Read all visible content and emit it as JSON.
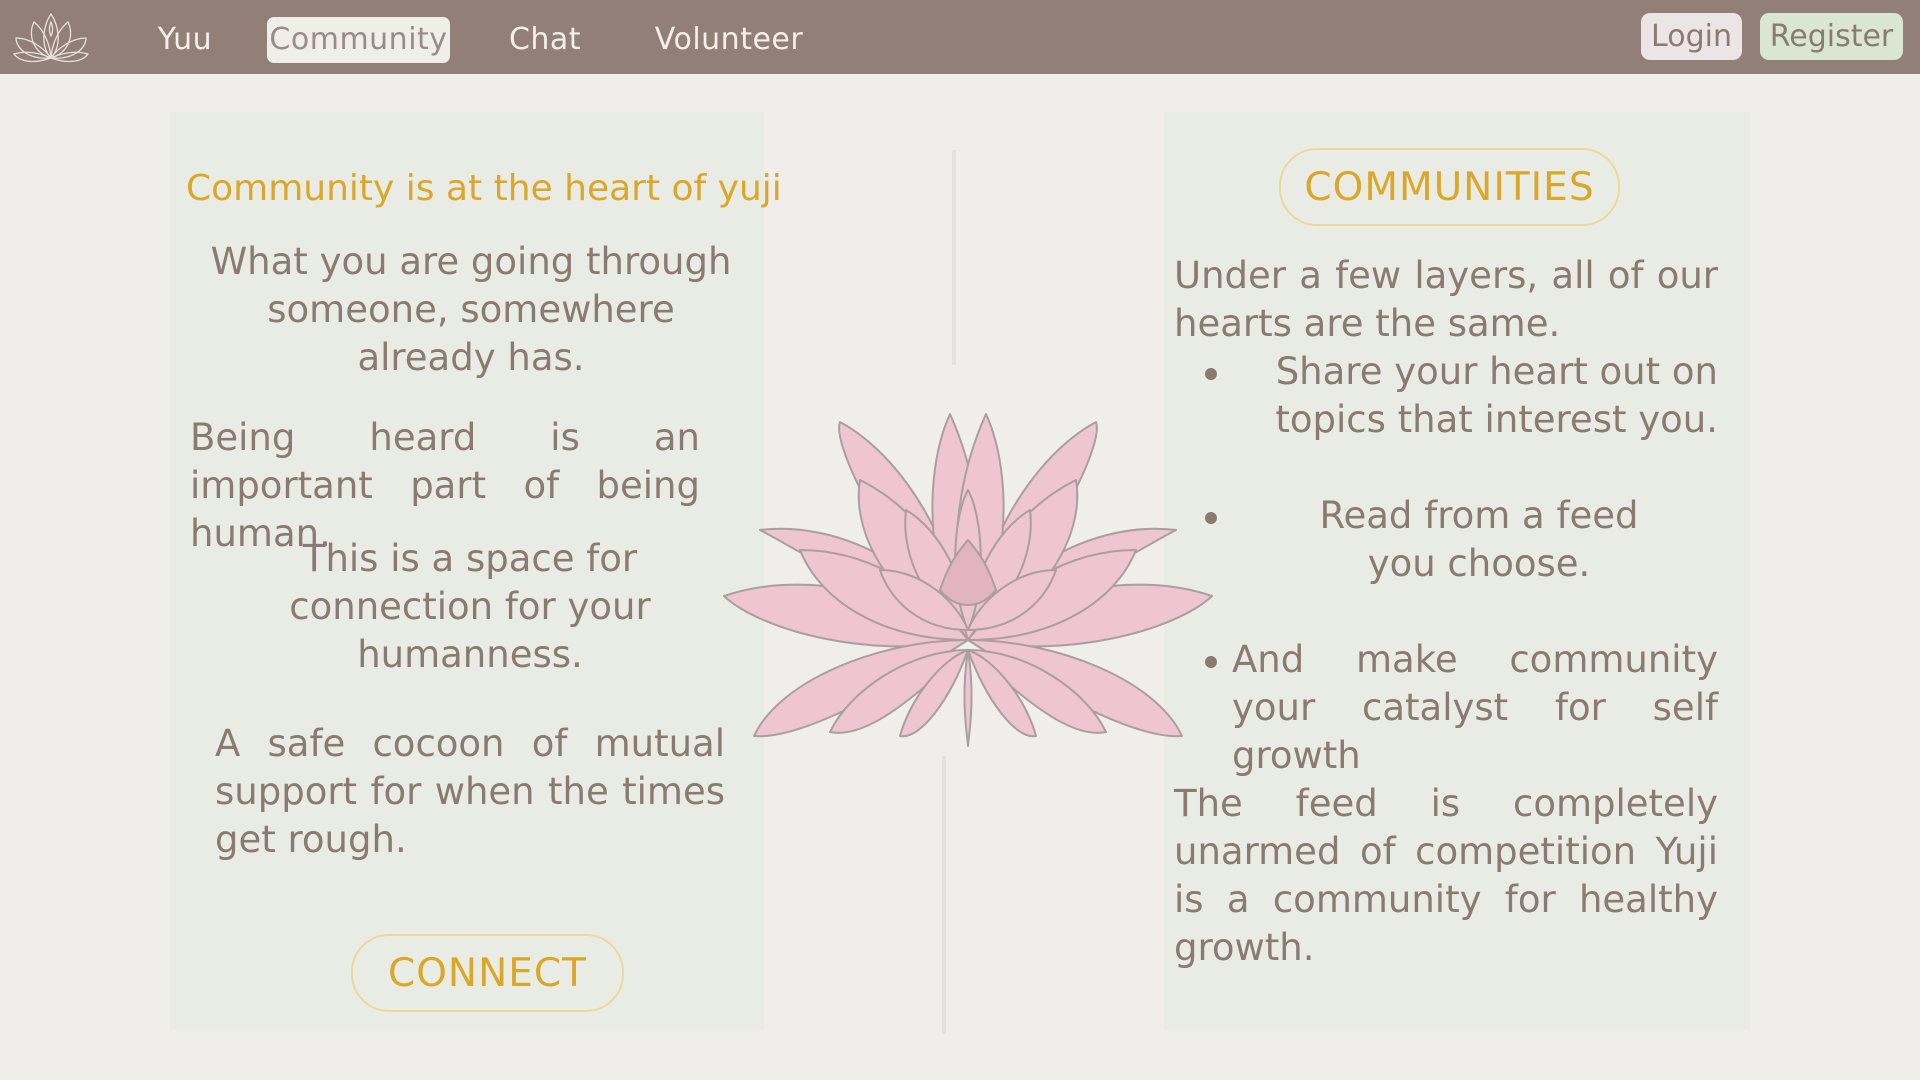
{
  "nav": {
    "items": [
      {
        "label": "Yuu"
      },
      {
        "label": "Community"
      },
      {
        "label": "Chat"
      },
      {
        "label": "Volunteer"
      }
    ],
    "login_label": "Login",
    "register_label": "Register"
  },
  "left": {
    "heading": "Community is at the heart of yuji",
    "para1": [
      "What you are going through",
      "someone, somewhere",
      "already has."
    ],
    "para2": "Being heard is an important part of being human.",
    "para3": [
      "This is a space for",
      "connection for your",
      "humanness."
    ],
    "para4": "A safe cocoon of mutual support for when the times get rough.",
    "connect_label": "CONNECT"
  },
  "right": {
    "communities_label": "COMMUNITIES",
    "intro": "Under a few layers, all of our hearts are the same.",
    "bullets": [
      "Share your heart out on topics that interest you.",
      "Read from a feed you choose.",
      "And make community your catalyst for self growth"
    ],
    "closing": "The feed is completely unarmed of competition Yuji is a community for healthy growth."
  },
  "colors": {
    "navbar": "#927f78",
    "accent": "#dba72a",
    "text": "#8b7a70",
    "lotus": "#eec5d1",
    "register_bg": "#d9e6d2"
  }
}
